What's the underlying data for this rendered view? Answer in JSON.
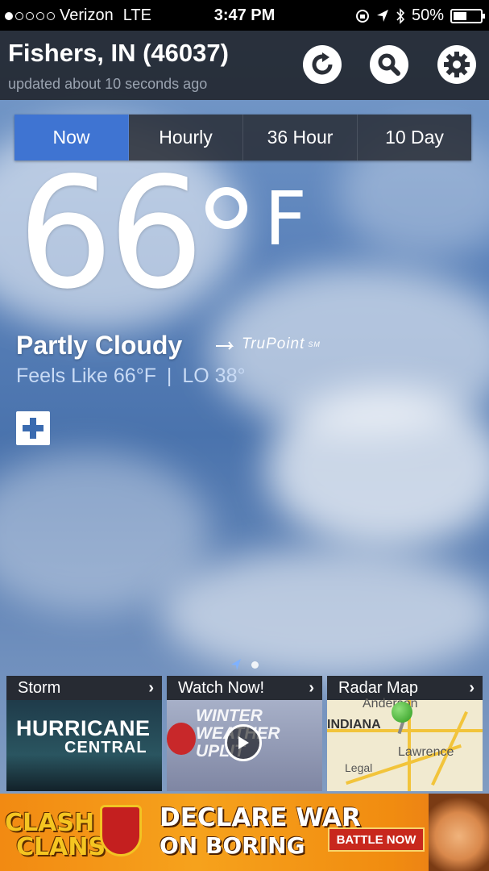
{
  "status_bar": {
    "carrier": "Verizon",
    "network": "LTE",
    "time": "3:47 PM",
    "battery": "50%",
    "battery_level": 0.5,
    "signal_bars": 1
  },
  "header": {
    "location": "Fishers, IN (46037)",
    "updated": "updated about 10 seconds ago",
    "icons": [
      "refresh-icon",
      "search-icon",
      "gear-icon"
    ]
  },
  "tabs": [
    {
      "label": "Now",
      "active": true
    },
    {
      "label": "Hourly",
      "active": false
    },
    {
      "label": "36 Hour",
      "active": false
    },
    {
      "label": "10 Day",
      "active": false
    }
  ],
  "current": {
    "temperature": "66",
    "unit": "F",
    "condition": "Partly Cloudy",
    "brand": "TruPoint",
    "brand_mark": "SM",
    "feels_like": "Feels Like 66°F",
    "separator": "|",
    "low": "LO 38°"
  },
  "cards": [
    {
      "title": "Storm",
      "line1": "HURRICANE",
      "line2": "CENTRAL"
    },
    {
      "title": "Watch Now!",
      "line1": "WINTER",
      "line2": "WEATHER",
      "line3": "UPLIT"
    },
    {
      "title": "Radar Map",
      "place1": "Anderson",
      "place2": "INDIANA",
      "place3": "Lawrence",
      "place4": "Legal"
    }
  ],
  "ad": {
    "brand_line1": "CLASH",
    "brand_line2": "CLANS",
    "line1": "DECLARE WAR",
    "line2": "ON BORING",
    "button": "BATTLE NOW"
  },
  "colors": {
    "accent": "#3f74d2",
    "header_bg": "#1e2128",
    "ad_orange": "#f28a12"
  }
}
